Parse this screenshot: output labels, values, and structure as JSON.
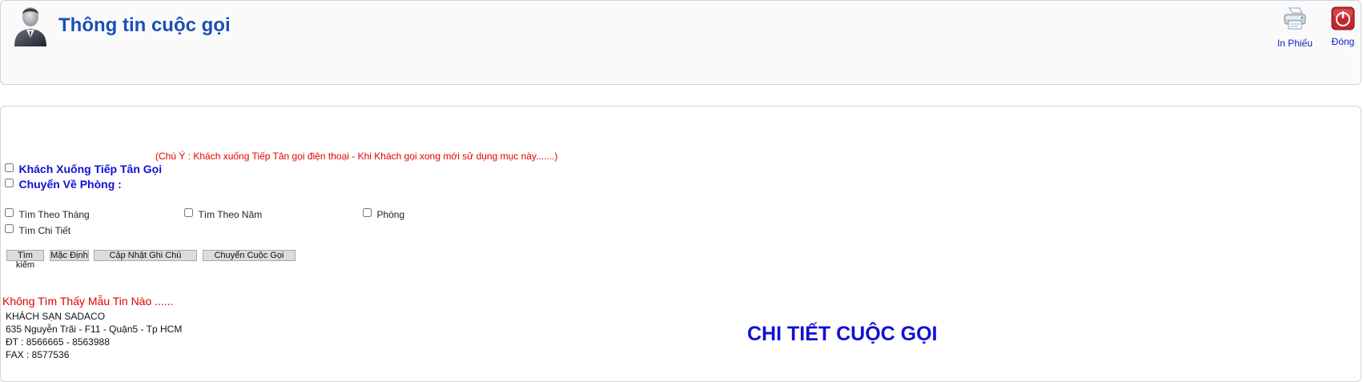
{
  "header": {
    "title": "Thông tin cuộc gọi",
    "print_label": "In Phiếu",
    "close_label": "Đóng",
    "print_icon": "printer-icon",
    "close_icon": "power-icon",
    "avatar_icon": "user-avatar-icon"
  },
  "form": {
    "note": "(Chú Ý : Khách xuống Tiếp Tân gọi điện thoại - Khi Khách gọi xong mới sử dụng mục này.......)",
    "guest_reception_label": "Khách Xuống Tiếp Tân Gọi",
    "guest_reception_checked": false,
    "transfer_room_label": "Chuyển Về Phòng :",
    "transfer_room_checked": false,
    "search_month_label": "Tìm Theo Tháng",
    "search_month_checked": false,
    "search_year_label": "Tìm Theo Năm",
    "search_year_checked": false,
    "room_label": "Phòng",
    "room_checked": false,
    "search_detail_label": "Tìm Chi Tiết",
    "search_detail_checked": false
  },
  "buttons": {
    "search": "Tìm kiếm",
    "default": "Mặc Định",
    "update_note": "Cập Nhật Ghi Chú",
    "transfer_call": "Chuyển Cuộc Gọi"
  },
  "results": {
    "not_found": "Không Tìm Thấy Mẫu Tin Nào ......"
  },
  "company": {
    "name": "KHÁCH SẠN SADACO",
    "address": "635 Nguyễn Trãi - F11 - Quận5 - Tp HCM",
    "phone": "ĐT : 8566665 - 8563988",
    "fax": "FAX : 8577536"
  },
  "detail": {
    "title": "CHI TIẾT CUỘC GỌI"
  },
  "colors": {
    "title": "#1a4fb8",
    "label_blue": "#1010d8",
    "warning_red": "#e00000",
    "link_blue": "#1020c0"
  }
}
